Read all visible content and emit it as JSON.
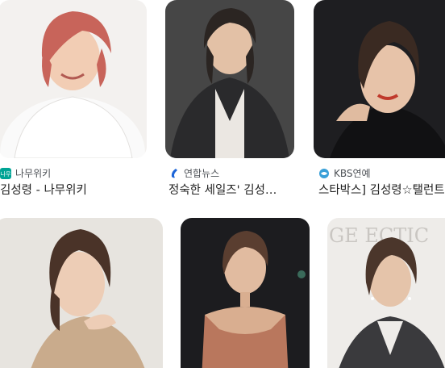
{
  "results": [
    {
      "source": "나무위키",
      "source_icon": "namuwiki-logo-icon",
      "source_icon_color": "#00a495",
      "caption": "김성령 - 나무위키"
    },
    {
      "source": "연합뉴스",
      "source_icon": "yonhap-logo-icon",
      "source_icon_color": "#1e66d8",
      "caption": "정숙한 세일즈' 김성…"
    },
    {
      "source": "KBS연예",
      "source_icon": "kbs-logo-icon",
      "source_icon_color": "#3aa0d8",
      "caption": "스타박스] 김성령☆탤런트"
    },
    {
      "source": "",
      "caption": ""
    },
    {
      "source": "",
      "caption": ""
    },
    {
      "source": "",
      "caption": ""
    }
  ],
  "watermark_text": "GE          ECTIC"
}
